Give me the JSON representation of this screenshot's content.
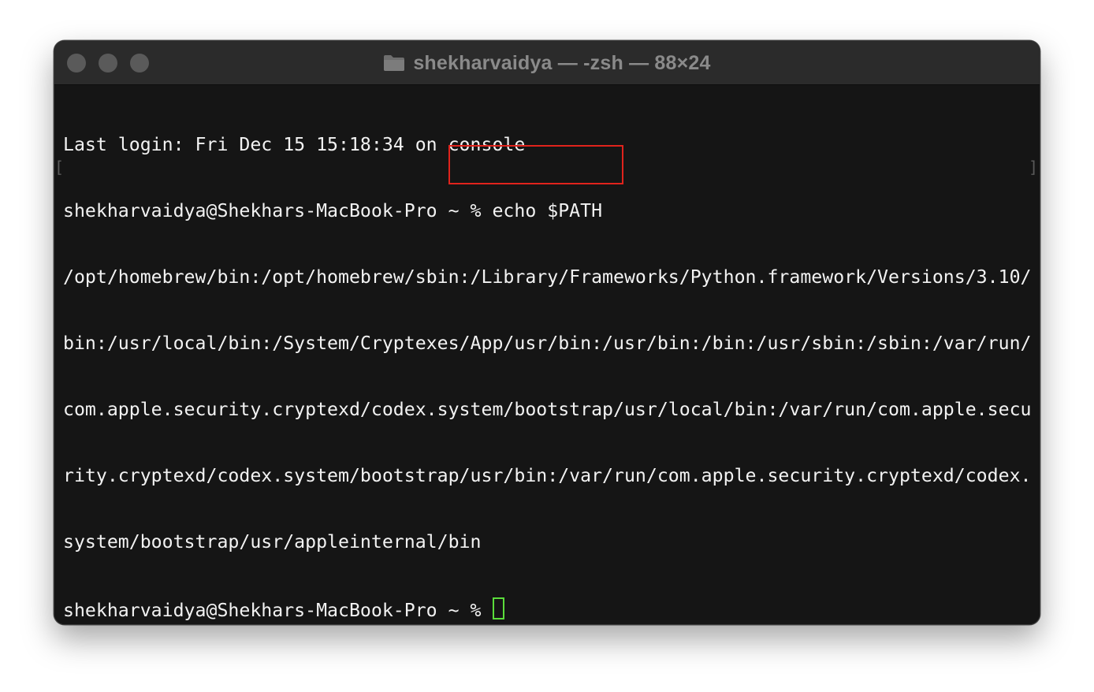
{
  "window": {
    "title": "shekharvaidya — -zsh — 88×24",
    "folder_icon": "folder-icon",
    "traffic_lights": [
      "close-button",
      "minimize-button",
      "zoom-button"
    ]
  },
  "terminal": {
    "lines": [
      "Last login: Fri Dec 15 15:18:34 on console",
      "shekharvaidya@Shekhars-MacBook-Pro ~ % echo $PATH",
      "/opt/homebrew/bin:/opt/homebrew/sbin:/Library/Frameworks/Python.framework/Versions/3.10/",
      "bin:/usr/local/bin:/System/Cryptexes/App/usr/bin:/usr/bin:/bin:/usr/sbin:/sbin:/var/run/",
      "com.apple.security.cryptexd/codex.system/bootstrap/usr/local/bin:/var/run/com.apple.secu",
      "rity.cryptexd/codex.system/bootstrap/usr/bin:/var/run/com.apple.security.cryptexd/codex.",
      "system/bootstrap/usr/appleinternal/bin"
    ],
    "prompt": "shekharvaidya@Shekhars-MacBook-Pro ~ % ",
    "mark_left": "[",
    "mark_right": "]"
  },
  "colors": {
    "background": "#151515",
    "text": "#f2f2f2",
    "cursor": "#5bdc3b",
    "highlight": "#e0231c",
    "titlebar": "#2b2b2b"
  }
}
